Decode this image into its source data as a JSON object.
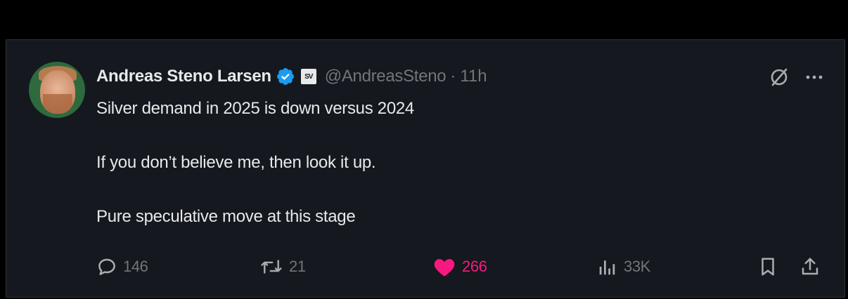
{
  "tweet": {
    "author_name": "Andreas Steno Larsen",
    "affiliation_badge": "SV",
    "handle": "@AndreasSteno",
    "separator": "·",
    "time": "11h",
    "body": [
      "Silver demand in 2025 is down versus 2024",
      "If you don’t believe me, then look it up.",
      "Pure speculative move at this stage"
    ]
  },
  "actions": {
    "replies": "146",
    "reposts": "21",
    "likes": "266",
    "views": "33K"
  },
  "icons": {
    "verified": "verified-badge-icon",
    "grok": "grok-icon",
    "more": "more-icon",
    "reply": "reply-icon",
    "repost": "repost-icon",
    "like": "heart-icon",
    "views": "views-icon",
    "bookmark": "bookmark-icon",
    "share": "share-icon"
  },
  "colors": {
    "background": "#15181e",
    "text": "#e7e9ea",
    "muted": "#71767b",
    "verified": "#1d9bf0",
    "like": "#f91880"
  }
}
